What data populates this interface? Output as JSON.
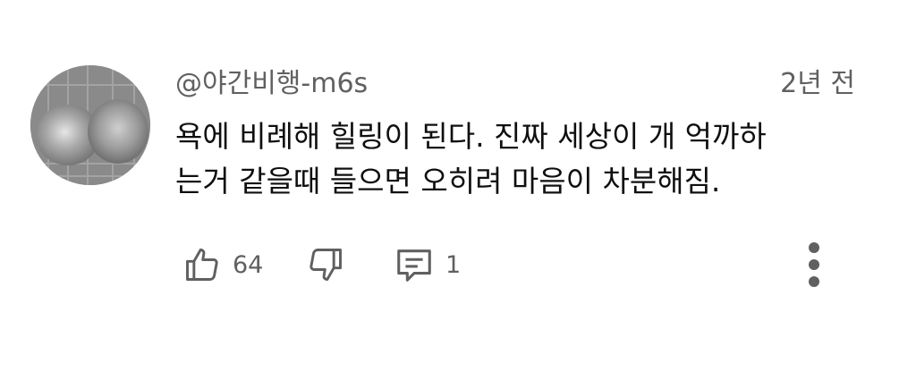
{
  "comment": {
    "author": "@야간비행-m6s",
    "timestamp": "2년 전",
    "text_lines": [
      "욕에 비례해 힐링이 된다. 진짜 세상이 개 억까하",
      "는거 같을때 들으면 오히려 마음이 차분해짐."
    ],
    "likes": "64",
    "replies": "1"
  },
  "icons": {
    "like": "thumbs-up-icon",
    "dislike": "thumbs-down-icon",
    "reply": "comment-icon",
    "more": "more-vertical-icon"
  },
  "colors": {
    "primary_text": "#0f0f0f",
    "secondary_text": "#606060",
    "icon": "#606060",
    "background": "#ffffff"
  }
}
